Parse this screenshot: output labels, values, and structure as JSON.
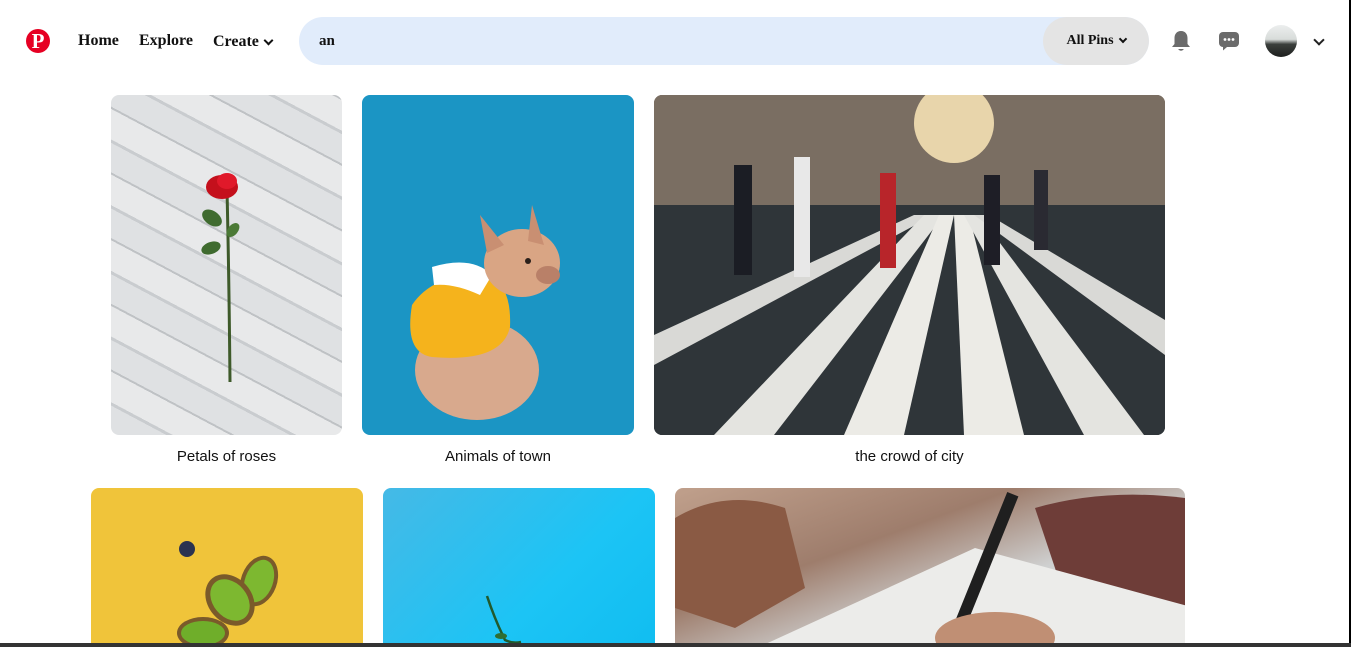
{
  "header": {
    "logo_letter": "P",
    "nav": {
      "home": "Home",
      "explore": "Explore",
      "create": "Create"
    },
    "search": {
      "value": "an",
      "filter_label": "All Pins"
    },
    "icons": {
      "logo": "pinterest-logo",
      "notifications": "bell-icon",
      "messages": "message-icon",
      "create_dropdown": "chevron-down-icon",
      "filter_dropdown": "chevron-down-icon",
      "account_dropdown": "chevron-down-icon"
    }
  },
  "pins": [
    {
      "caption": "Petals of roses"
    },
    {
      "caption": "Animals of town"
    },
    {
      "caption": "the crowd of city"
    },
    {
      "caption": ""
    },
    {
      "caption": ""
    },
    {
      "caption": ""
    }
  ],
  "colors": {
    "brand": "#e60023",
    "search_bg": "#e1ecfb",
    "filter_bg": "#e4e4e4"
  }
}
